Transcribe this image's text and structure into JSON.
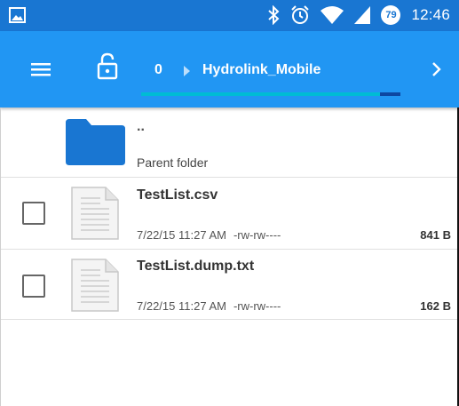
{
  "status_bar": {
    "time": "12:46",
    "battery_badge": "79",
    "icons": [
      "gallery-icon",
      "bluetooth-icon",
      "alarm-icon",
      "wifi-icon",
      "cell-signal-icon"
    ]
  },
  "toolbar": {
    "icons": [
      "menu-icon",
      "lock-icon",
      "chevron-right-icon"
    ],
    "breadcrumb": {
      "root": "0",
      "current": "Hydrolink_Mobile"
    },
    "progress": 0.92,
    "colors": {
      "status_bar": "#1976d2",
      "toolbar": "#2196f3",
      "progress_track": "#0d47a1",
      "progress_fill": "#00bcd4"
    }
  },
  "list": {
    "parent": {
      "name": "..",
      "label": "Parent folder",
      "icon": "folder-icon",
      "color": "#1976d2"
    },
    "files": [
      {
        "name": "TestList.csv",
        "date": "7/22/15 11:27 AM",
        "perms": "-rw-rw----",
        "size": "841 B",
        "icon": "document-icon"
      },
      {
        "name": "TestList.dump.txt",
        "date": "7/22/15 11:27 AM",
        "perms": "-rw-rw----",
        "size": "162 B",
        "icon": "document-icon"
      }
    ]
  }
}
